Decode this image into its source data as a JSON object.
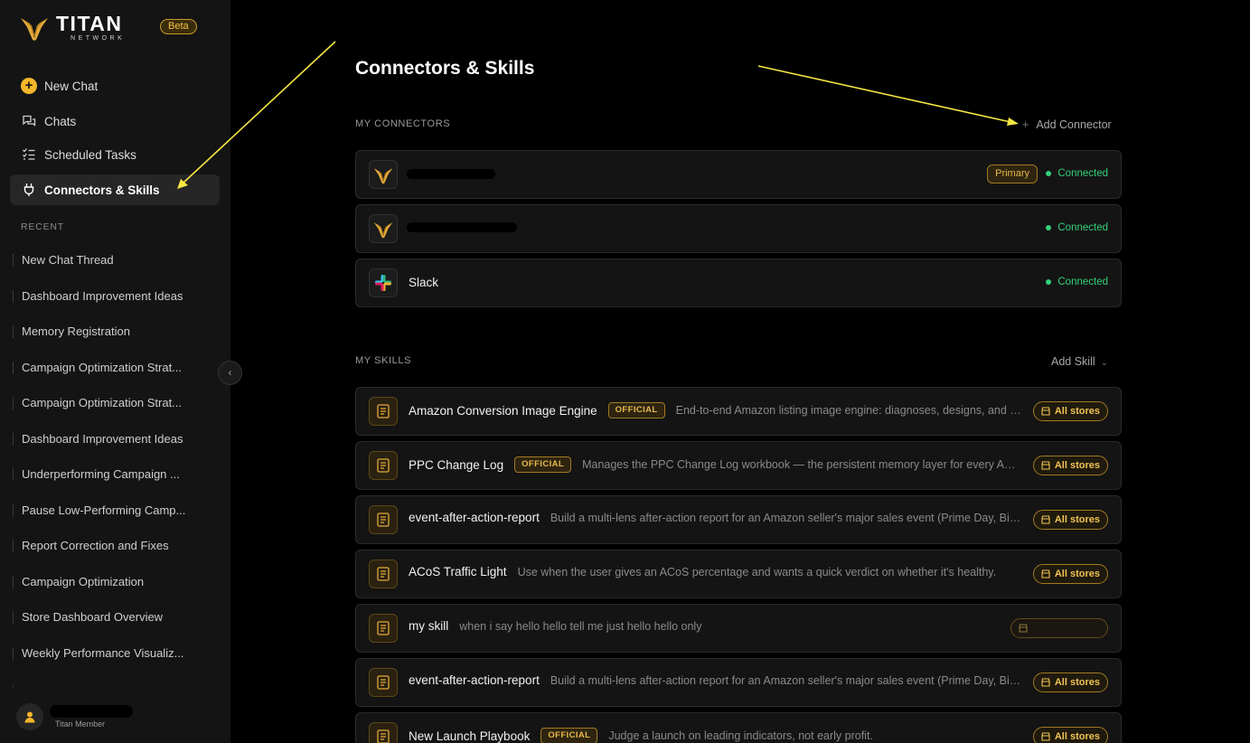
{
  "brand": {
    "name": "TITAN",
    "sub": "NETWORK",
    "badge": "Beta"
  },
  "nav": {
    "new_chat": "New Chat",
    "chats": "Chats",
    "scheduled": "Scheduled Tasks",
    "connectors": "Connectors & Skills"
  },
  "recent": {
    "label": "RECENT",
    "items": [
      "New Chat Thread",
      "Dashboard Improvement Ideas",
      "Memory Registration",
      "Campaign Optimization Strat...",
      "Campaign Optimization Strat...",
      "Dashboard Improvement Ideas",
      "Underperforming Campaign ...",
      "Pause Low-Performing Camp...",
      "Report Correction and Fixes",
      "Campaign Optimization",
      "Store Dashboard Overview",
      "Weekly Performance Visualiz..."
    ]
  },
  "user": {
    "role": "Titan Member"
  },
  "page": {
    "title": "Connectors & Skills",
    "connectors_label": "MY CONNECTORS",
    "add_connector": "Add Connector",
    "skills_label": "MY SKILLS",
    "add_skill": "Add Skill"
  },
  "connectors": [
    {
      "name": "",
      "primary": "Primary",
      "status": "Connected"
    },
    {
      "name": "",
      "status": "Connected"
    },
    {
      "name": "Slack",
      "status": "Connected"
    }
  ],
  "skills": [
    {
      "name": "Amazon Conversion Image Engine",
      "official": "OFFICIAL",
      "desc": "End-to-end Amazon listing image engine: diagnoses, designs, and specs every image slot for maximum conversion",
      "scope": "All stores"
    },
    {
      "name": "PPC Change Log",
      "official": "OFFICIAL",
      "desc": "Manages the PPC Change Log workbook — the persistent memory layer for every Amazon PPC change",
      "scope": "All stores"
    },
    {
      "name": "event-after-action-report",
      "desc": "Build a multi-lens after-action report for an Amazon seller's major sales event (Prime Day, Big Deal Days)",
      "scope": "All stores"
    },
    {
      "name": "ACoS Traffic Light",
      "desc": "Use when the user gives an ACoS percentage and wants a quick verdict on whether it's healthy.",
      "scope": "All stores"
    },
    {
      "name": "my skill",
      "desc": "when i say hello hello tell me just hello hello only",
      "scope": ""
    },
    {
      "name": "event-after-action-report",
      "desc": "Build a multi-lens after-action report for an Amazon seller's major sales event (Prime Day, Big Deal Days)",
      "scope": "All stores"
    },
    {
      "name": "New Launch Playbook",
      "official": "OFFICIAL",
      "desc": "Judge a launch on leading indicators, not early profit.",
      "scope": "All stores"
    }
  ],
  "colors": {
    "accent": "#f4b62a",
    "connected": "#33d17a",
    "annotation": "#f5e642"
  }
}
